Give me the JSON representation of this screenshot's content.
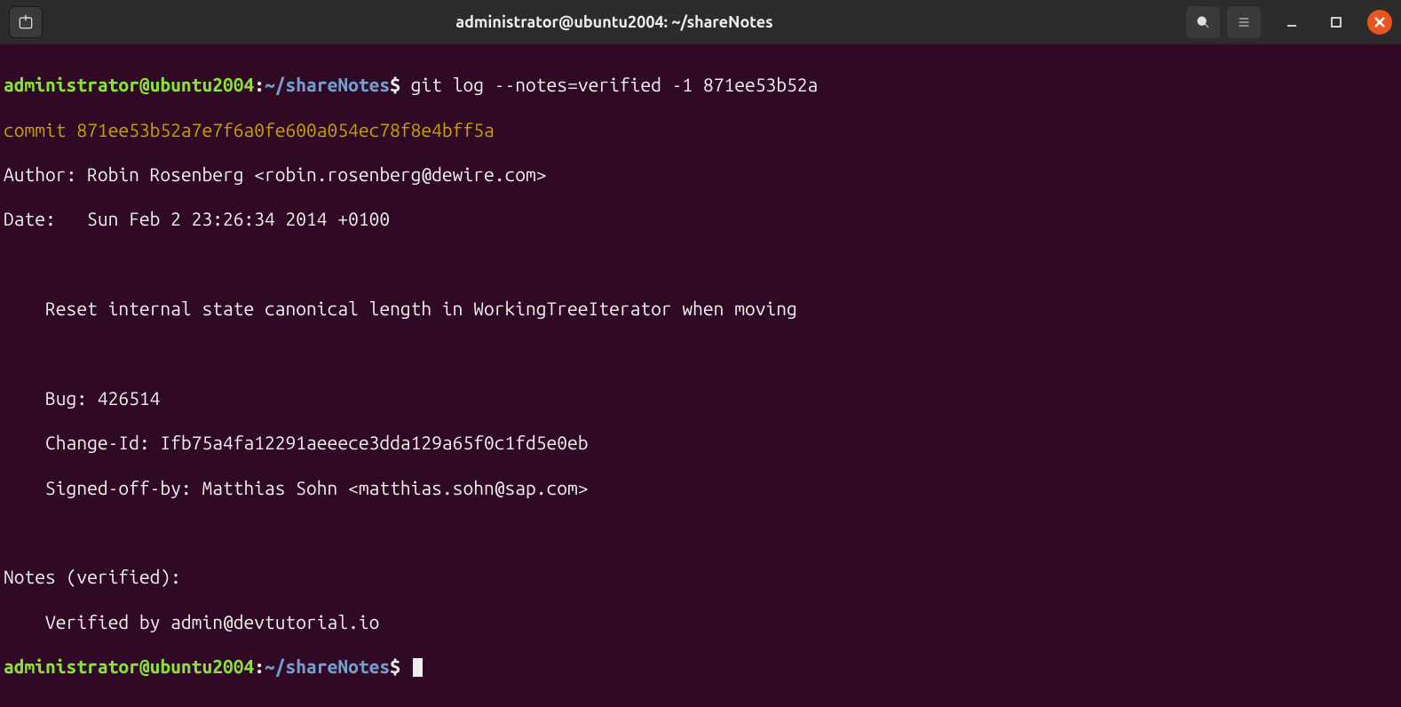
{
  "titlebar": {
    "title": "administrator@ubuntu2004: ~/shareNotes"
  },
  "terminal": {
    "prompt_user": "administrator@ubuntu2004",
    "prompt_colon": ":",
    "prompt_path": "~/shareNotes",
    "prompt_dollar": "$",
    "command": "git log --notes=verified -1 871ee53b52a",
    "commit_line": "commit 871ee53b52a7e7f6a0fe600a054ec78f8e4bff5a",
    "author_line": "Author: Robin Rosenberg <robin.rosenberg@dewire.com>",
    "date_line": "Date:   Sun Feb 2 23:26:34 2014 +0100",
    "msg_subject": "    Reset internal state canonical length in WorkingTreeIterator when moving",
    "msg_bug": "    Bug: 426514",
    "msg_changeid": "    Change-Id: Ifb75a4fa12291aeeece3dda129a65f0c1fd5e0eb",
    "msg_signed": "    Signed-off-by: Matthias Sohn <matthias.sohn@sap.com>",
    "notes_header": "Notes (verified):",
    "notes_body": "    Verified by admin@devtutorial.io"
  }
}
